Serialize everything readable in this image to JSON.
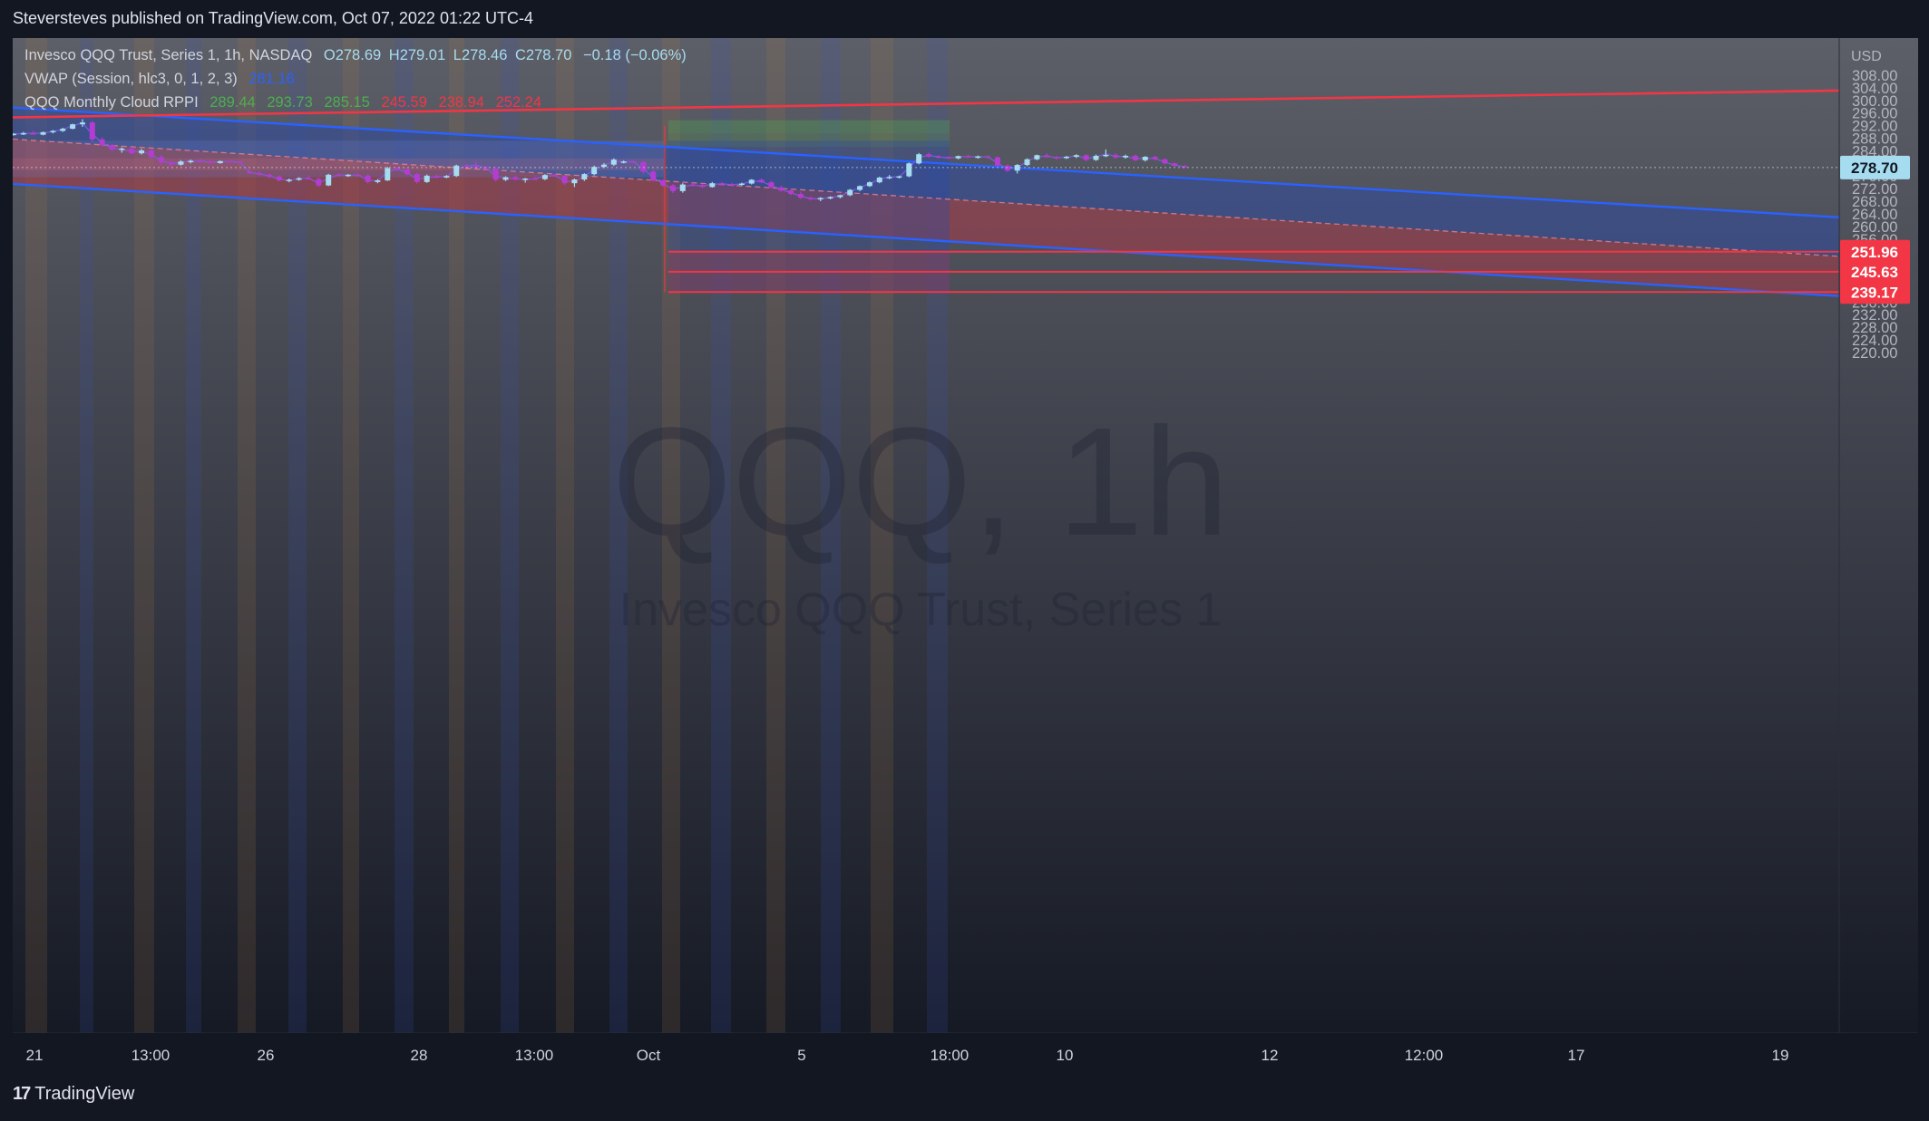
{
  "header": {
    "published": "Steversteves published on TradingView.com, Oct 07, 2022 01:22 UTC-4"
  },
  "legend": {
    "symbol": {
      "name": "Invesco QQQ Trust, Series 1, 1h, NASDAQ",
      "open": "O278.69",
      "high": "H279.01",
      "low": "L278.46",
      "close": "C278.70",
      "change": "−0.18 (−0.06%)"
    },
    "vwap": {
      "name": "VWAP (Session, hlc3, 0, 1, 2, 3)",
      "value": "281.16"
    },
    "cloud": {
      "name": "QQQ Monthly Cloud RPPI",
      "values": [
        "289.44",
        "293.73",
        "285.15",
        "245.59",
        "238.94",
        "252.24"
      ]
    }
  },
  "watermark": {
    "symbol": "QQQ, 1h",
    "description": "Invesco QQQ Trust, Series 1"
  },
  "footer": {
    "brand": "TradingView"
  },
  "colors": {
    "background_top": "#5d5f68",
    "background_bottom": "#131722",
    "up_candle": "#a6dcf0",
    "down_candle": "#b43cd2",
    "channel_line": "#2962ff",
    "resistance_line": "#f23645",
    "blue_fill": "#2f4aa0",
    "red_fill": "#a83a48",
    "green_zone": "#4caf50",
    "last_price_label": "#a6dcf0"
  },
  "chart_data": {
    "type": "candlestick",
    "currency": "USD",
    "ylim": [
      216,
      310
    ],
    "y_ticks": [
      220,
      224,
      228,
      232,
      236,
      240,
      244,
      248,
      252,
      256,
      260,
      264,
      268,
      272,
      276,
      280,
      284,
      288,
      292,
      296,
      300,
      304,
      308
    ],
    "x_tick_labels": [
      "21",
      "13:00",
      "26",
      "28",
      "13:00",
      "Oct",
      "5",
      "18:00",
      "10",
      "12",
      "12:00",
      "17",
      "19"
    ],
    "last_price": {
      "label": "278.70",
      "value": 278.7
    },
    "price_levels": [
      {
        "label": "251.96",
        "value": 251.96
      },
      {
        "label": "245.63",
        "value": 245.63
      },
      {
        "label": "239.17",
        "value": 239.17
      }
    ],
    "candles": [
      [
        289.0,
        289.6,
        288.8,
        289.4
      ],
      [
        289.4,
        290.0,
        289.0,
        289.6
      ],
      [
        289.6,
        290.3,
        289.2,
        289.1
      ],
      [
        289.1,
        290.1,
        288.9,
        289.9
      ],
      [
        289.9,
        290.6,
        289.5,
        290.3
      ],
      [
        290.3,
        291.3,
        290.0,
        291.0
      ],
      [
        291.0,
        292.6,
        290.8,
        292.4
      ],
      [
        292.4,
        294.0,
        291.6,
        293.0
      ],
      [
        293.0,
        293.4,
        286.8,
        287.6
      ],
      [
        287.6,
        288.2,
        285.4,
        285.8
      ],
      [
        285.8,
        286.1,
        283.9,
        284.4
      ],
      [
        284.4,
        285.1,
        283.4,
        284.7
      ],
      [
        284.7,
        285.2,
        282.9,
        283.2
      ],
      [
        283.2,
        284.6,
        282.8,
        284.1
      ],
      [
        284.1,
        284.6,
        281.6,
        282.0
      ],
      [
        282.0,
        282.6,
        279.7,
        280.4
      ],
      [
        280.4,
        281.2,
        279.0,
        279.6
      ],
      [
        279.6,
        281.0,
        279.3,
        280.6
      ],
      [
        280.6,
        281.2,
        280.0,
        280.8
      ],
      [
        280.8,
        281.4,
        280.3,
        280.6
      ],
      [
        280.6,
        281.0,
        279.8,
        280.1
      ],
      [
        280.1,
        280.9,
        279.9,
        280.7
      ],
      [
        280.7,
        281.1,
        280.3,
        280.5
      ],
      [
        280.5,
        280.8,
        279.9,
        280.3
      ],
      [
        277.4,
        277.9,
        276.6,
        276.9
      ],
      [
        276.9,
        277.5,
        276.1,
        276.4
      ],
      [
        276.4,
        276.8,
        275.3,
        275.8
      ],
      [
        275.8,
        276.2,
        274.3,
        274.6
      ],
      [
        274.6,
        275.2,
        274.0,
        274.8
      ],
      [
        274.8,
        275.6,
        274.5,
        275.3
      ],
      [
        275.3,
        276.0,
        274.9,
        275.0
      ],
      [
        275.0,
        275.5,
        272.5,
        273.0
      ],
      [
        273.0,
        276.7,
        272.8,
        276.4
      ],
      [
        276.4,
        276.9,
        275.9,
        276.2
      ],
      [
        276.2,
        276.6,
        275.7,
        276.4
      ],
      [
        276.4,
        276.9,
        275.9,
        276.1
      ],
      [
        276.1,
        276.5,
        273.6,
        274.1
      ],
      [
        274.1,
        275.0,
        273.7,
        274.6
      ],
      [
        274.6,
        278.9,
        274.4,
        278.5
      ],
      [
        278.5,
        278.9,
        277.6,
        278.1
      ],
      [
        278.1,
        278.5,
        276.2,
        276.6
      ],
      [
        276.6,
        277.1,
        273.6,
        274.1
      ],
      [
        274.1,
        276.5,
        273.8,
        276.1
      ],
      [
        276.1,
        276.4,
        275.2,
        275.5
      ],
      [
        275.5,
        276.3,
        275.3,
        276.0
      ],
      [
        276.0,
        279.6,
        275.7,
        279.3
      ],
      [
        279.3,
        279.8,
        278.6,
        279.1
      ],
      [
        279.1,
        280.6,
        278.8,
        278.9
      ],
      [
        278.9,
        279.3,
        278.0,
        278.4
      ],
      [
        278.4,
        278.8,
        274.3,
        274.8
      ],
      [
        274.8,
        275.9,
        274.4,
        275.6
      ],
      [
        275.6,
        276.1,
        274.6,
        274.9
      ],
      [
        274.9,
        275.4,
        273.9,
        275.2
      ],
      [
        275.2,
        275.7,
        274.8,
        275.0
      ],
      [
        275.0,
        276.6,
        274.7,
        276.3
      ],
      [
        276.3,
        276.7,
        275.9,
        276.0
      ],
      [
        276.0,
        276.2,
        273.2,
        273.7
      ],
      [
        273.7,
        275.2,
        272.5,
        274.9
      ],
      [
        274.9,
        276.9,
        274.4,
        276.6
      ],
      [
        276.6,
        279.3,
        276.2,
        278.9
      ],
      [
        278.9,
        280.1,
        278.5,
        279.6
      ],
      [
        279.6,
        281.6,
        279.2,
        281.2
      ],
      [
        280.5,
        280.9,
        280.0,
        280.6
      ],
      [
        280.6,
        281.0,
        280.1,
        280.4
      ],
      [
        280.4,
        280.7,
        276.8,
        277.4
      ],
      [
        277.4,
        277.8,
        274.1,
        274.6
      ],
      [
        274.6,
        275.0,
        272.6,
        273.0
      ],
      [
        273.0,
        273.4,
        270.6,
        271.2
      ],
      [
        271.2,
        273.7,
        270.7,
        273.3
      ],
      [
        273.3,
        273.8,
        272.6,
        273.1
      ],
      [
        273.1,
        273.6,
        272.2,
        272.5
      ],
      [
        272.5,
        274.1,
        272.3,
        273.7
      ],
      [
        273.7,
        274.1,
        273.0,
        273.4
      ],
      [
        273.4,
        273.8,
        272.7,
        273.2
      ],
      [
        273.2,
        273.9,
        272.9,
        273.6
      ],
      [
        273.6,
        275.0,
        273.3,
        274.8
      ],
      [
        274.8,
        275.2,
        273.7,
        274.0
      ],
      [
        274.0,
        274.4,
        272.0,
        272.4
      ],
      [
        272.4,
        272.9,
        271.0,
        271.4
      ],
      [
        271.4,
        271.8,
        269.9,
        270.3
      ],
      [
        270.3,
        271.0,
        268.7,
        269.1
      ],
      [
        269.1,
        269.6,
        268.2,
        268.6
      ],
      [
        268.6,
        269.3,
        268.0,
        269.0
      ],
      [
        269.0,
        269.6,
        268.6,
        269.3
      ],
      [
        269.3,
        270.1,
        268.9,
        269.9
      ],
      [
        269.9,
        271.9,
        269.6,
        271.6
      ],
      [
        271.6,
        273.0,
        271.2,
        272.8
      ],
      [
        272.8,
        274.3,
        272.5,
        274.0
      ],
      [
        274.0,
        275.8,
        273.7,
        275.5
      ],
      [
        275.5,
        276.3,
        275.0,
        275.7
      ],
      [
        275.7,
        276.1,
        275.2,
        275.9
      ],
      [
        275.9,
        280.3,
        275.6,
        280.0
      ],
      [
        280.0,
        283.3,
        279.7,
        282.9
      ],
      [
        282.9,
        283.4,
        281.8,
        282.2
      ],
      [
        282.2,
        282.6,
        281.6,
        282.0
      ],
      [
        282.0,
        282.3,
        281.3,
        281.6
      ],
      [
        281.6,
        282.5,
        281.3,
        282.3
      ],
      [
        282.3,
        282.8,
        281.8,
        282.0
      ],
      [
        282.0,
        282.5,
        281.5,
        282.2
      ],
      [
        282.2,
        282.6,
        281.7,
        281.9
      ],
      [
        281.9,
        282.2,
        278.9,
        279.3
      ],
      [
        279.3,
        279.7,
        277.3,
        277.7
      ],
      [
        277.7,
        279.8,
        276.8,
        279.5
      ],
      [
        279.5,
        281.6,
        279.1,
        281.3
      ],
      [
        281.3,
        282.8,
        281.0,
        282.6
      ],
      [
        282.6,
        283.1,
        281.8,
        282.0
      ],
      [
        282.0,
        282.4,
        281.2,
        281.7
      ],
      [
        281.7,
        282.4,
        281.4,
        282.1
      ],
      [
        282.1,
        282.9,
        281.7,
        282.6
      ],
      [
        282.6,
        282.9,
        280.7,
        281.1
      ],
      [
        281.1,
        282.8,
        280.8,
        282.4
      ],
      [
        282.4,
        284.4,
        282.0,
        282.7
      ],
      [
        282.7,
        283.2,
        281.5,
        281.9
      ],
      [
        281.9,
        282.8,
        281.5,
        282.4
      ],
      [
        282.4,
        282.8,
        280.7,
        281.0
      ],
      [
        281.0,
        282.3,
        280.6,
        282.1
      ],
      [
        282.1,
        282.4,
        280.9,
        281.3
      ],
      [
        281.3,
        281.6,
        279.6,
        280.0
      ],
      [
        280.0,
        280.3,
        278.9,
        279.2
      ],
      [
        279.2,
        279.5,
        278.5,
        278.7
      ]
    ]
  }
}
